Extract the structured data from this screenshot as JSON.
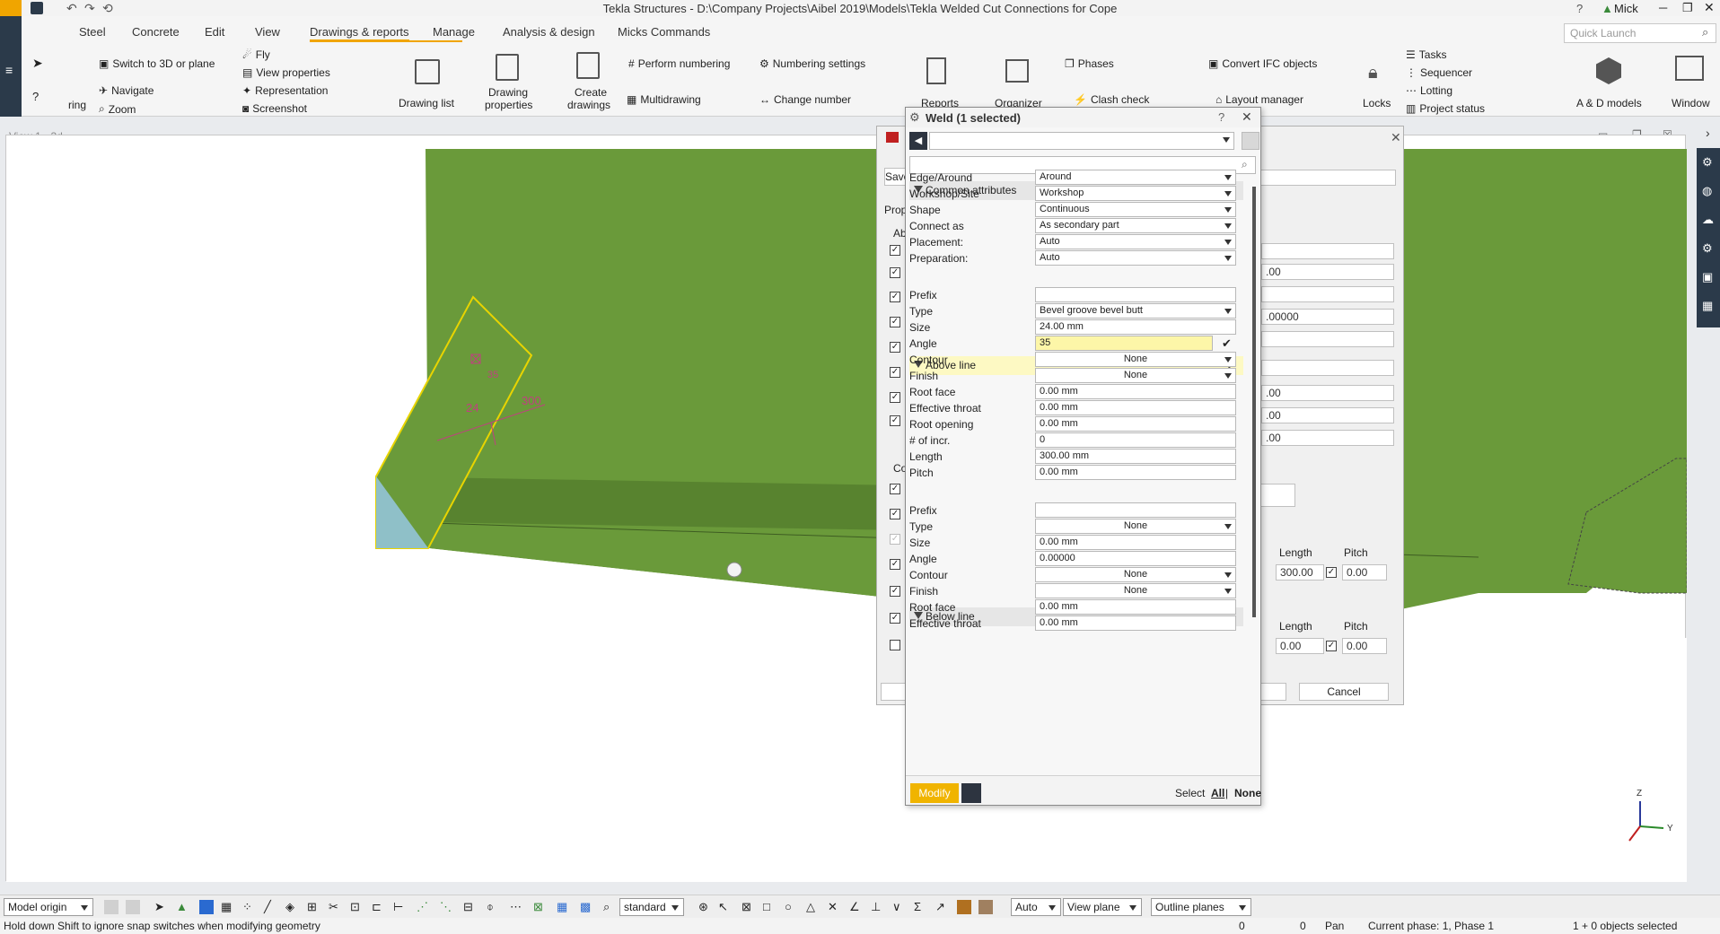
{
  "titlebar": {
    "title": "Tekla Structures - D:\\Company Projects\\Aibel 2019\\Models\\Tekla Welded Cut Connections for Cope",
    "user": "Mick",
    "help": "?"
  },
  "ribbon": {
    "tabs": [
      "Steel",
      "Concrete",
      "Edit",
      "View",
      "Drawings & reports",
      "Manage",
      "Analysis & design",
      "Micks Commands"
    ],
    "quick_launch_placeholder": "Quick Launch",
    "view_group": {
      "switch_3d": "Switch to 3D or plane",
      "navigate": "Navigate",
      "zoom": "Zoom",
      "fly": "Fly",
      "view_properties": "View properties",
      "representation": "Representation",
      "screenshot": "Screenshot",
      "ring": "ring"
    },
    "drawings_group": {
      "drawing_list": "Drawing list",
      "drawing_properties_1": "Drawing",
      "drawing_properties_2": "properties",
      "create_drawings_1": "Create",
      "create_drawings_2": "drawings",
      "perform_numbering": "Perform numbering",
      "numbering_settings": "Numbering settings",
      "multidrawing": "Multidrawing",
      "change_number": "Change number",
      "reports": "Reports"
    },
    "manage_group": {
      "organizer": "Organizer",
      "phases": "Phases",
      "clash_check": "Clash check",
      "convert_ifc": "Convert IFC objects",
      "layout_manager": "Layout manager",
      "locks": "Locks",
      "tasks": "Tasks",
      "sequencer": "Sequencer",
      "lotting": "Lotting",
      "project_status": "Project status",
      "ad_models": "A & D models",
      "window": "Window"
    }
  },
  "view": {
    "title": "View 1 - 3d",
    "weld_symbol_left": "24",
    "weld_symbol_right": "300",
    "weld_symbol_angle": "35"
  },
  "bg_dialog": {
    "save_label": "Save",
    "properties_label": "Prop",
    "ab_label": "Ab",
    "co_label": "Co",
    "fields": [
      ".00",
      ".00000",
      ".00",
      ".00",
      ".00"
    ],
    "length_header_1": "Length",
    "pitch_header_1": "Pitch",
    "length_value_1": "300.00",
    "pitch_value_1": "0.00",
    "length_header_2": "Length",
    "pitch_header_2": "Pitch",
    "length_value_2": "0.00",
    "pitch_value_2": "0.00",
    "cancel": "Cancel"
  },
  "weld_panel": {
    "title": "Weld (1 selected)",
    "help": "?",
    "common_attributes": "Common attributes",
    "common": [
      {
        "label": "Edge/Around",
        "value": "Around",
        "dropdown": true
      },
      {
        "label": "Workshop/Site",
        "value": "Workshop",
        "dropdown": true
      },
      {
        "label": "Shape",
        "value": "Continuous",
        "dropdown": true
      },
      {
        "label": "Connect as",
        "value": "As secondary part",
        "dropdown": true
      },
      {
        "label": "Placement:",
        "value": "Auto",
        "dropdown": true
      },
      {
        "label": "Preparation:",
        "value": "Auto",
        "dropdown": true
      }
    ],
    "above_line": "Above line",
    "above": [
      {
        "label": "Prefix",
        "value": ""
      },
      {
        "label": "Type",
        "value": "Bevel groove bevel butt",
        "dropdown": true
      },
      {
        "label": "Size",
        "value": "24.00 mm"
      },
      {
        "label": "Angle",
        "value": "35",
        "editing": true
      },
      {
        "label": "Contour",
        "value": "None",
        "dropdown": true,
        "center": true
      },
      {
        "label": "Finish",
        "value": "None",
        "dropdown": true,
        "center": true
      },
      {
        "label": "Root face",
        "value": "0.00 mm"
      },
      {
        "label": "Effective throat",
        "value": "0.00 mm"
      },
      {
        "label": "Root opening",
        "value": "0.00 mm"
      },
      {
        "label": "# of incr.",
        "value": "0"
      },
      {
        "label": "Length",
        "value": "300.00 mm"
      },
      {
        "label": "Pitch",
        "value": "0.00 mm"
      }
    ],
    "below_line": "Below line",
    "below": [
      {
        "label": "Prefix",
        "value": ""
      },
      {
        "label": "Type",
        "value": "None",
        "dropdown": true,
        "center": true
      },
      {
        "label": "Size",
        "value": "0.00 mm"
      },
      {
        "label": "Angle",
        "value": "0.00000"
      },
      {
        "label": "Contour",
        "value": "None",
        "dropdown": true,
        "center": true
      },
      {
        "label": "Finish",
        "value": "None",
        "dropdown": true,
        "center": true
      },
      {
        "label": "Root face",
        "value": "0.00 mm"
      },
      {
        "label": "Effective throat",
        "value": "0.00 mm"
      }
    ],
    "modify": "Modify",
    "select_label": "Select",
    "select_all": "All",
    "select_sep": "|",
    "select_none": "None"
  },
  "bottom_toolbar": {
    "model_origin": "Model origin",
    "standard": "standard",
    "auto": "Auto",
    "view_plane": "View plane",
    "outline_planes": "Outline planes"
  },
  "statusbar": {
    "hint": "Hold down Shift to ignore snap switches when modifying geometry",
    "x": "0",
    "y": "0",
    "mode": "Pan",
    "phase": "Current phase: 1, Phase 1",
    "selection": "1 + 0 objects selected"
  },
  "axes": {
    "z": "Z",
    "y": "Y"
  },
  "colors": {
    "accent": "#f0a500",
    "beam_green": "#6a9a3a",
    "weld_highlight": "#fdf9c3",
    "modify_button": "#f0b400"
  }
}
